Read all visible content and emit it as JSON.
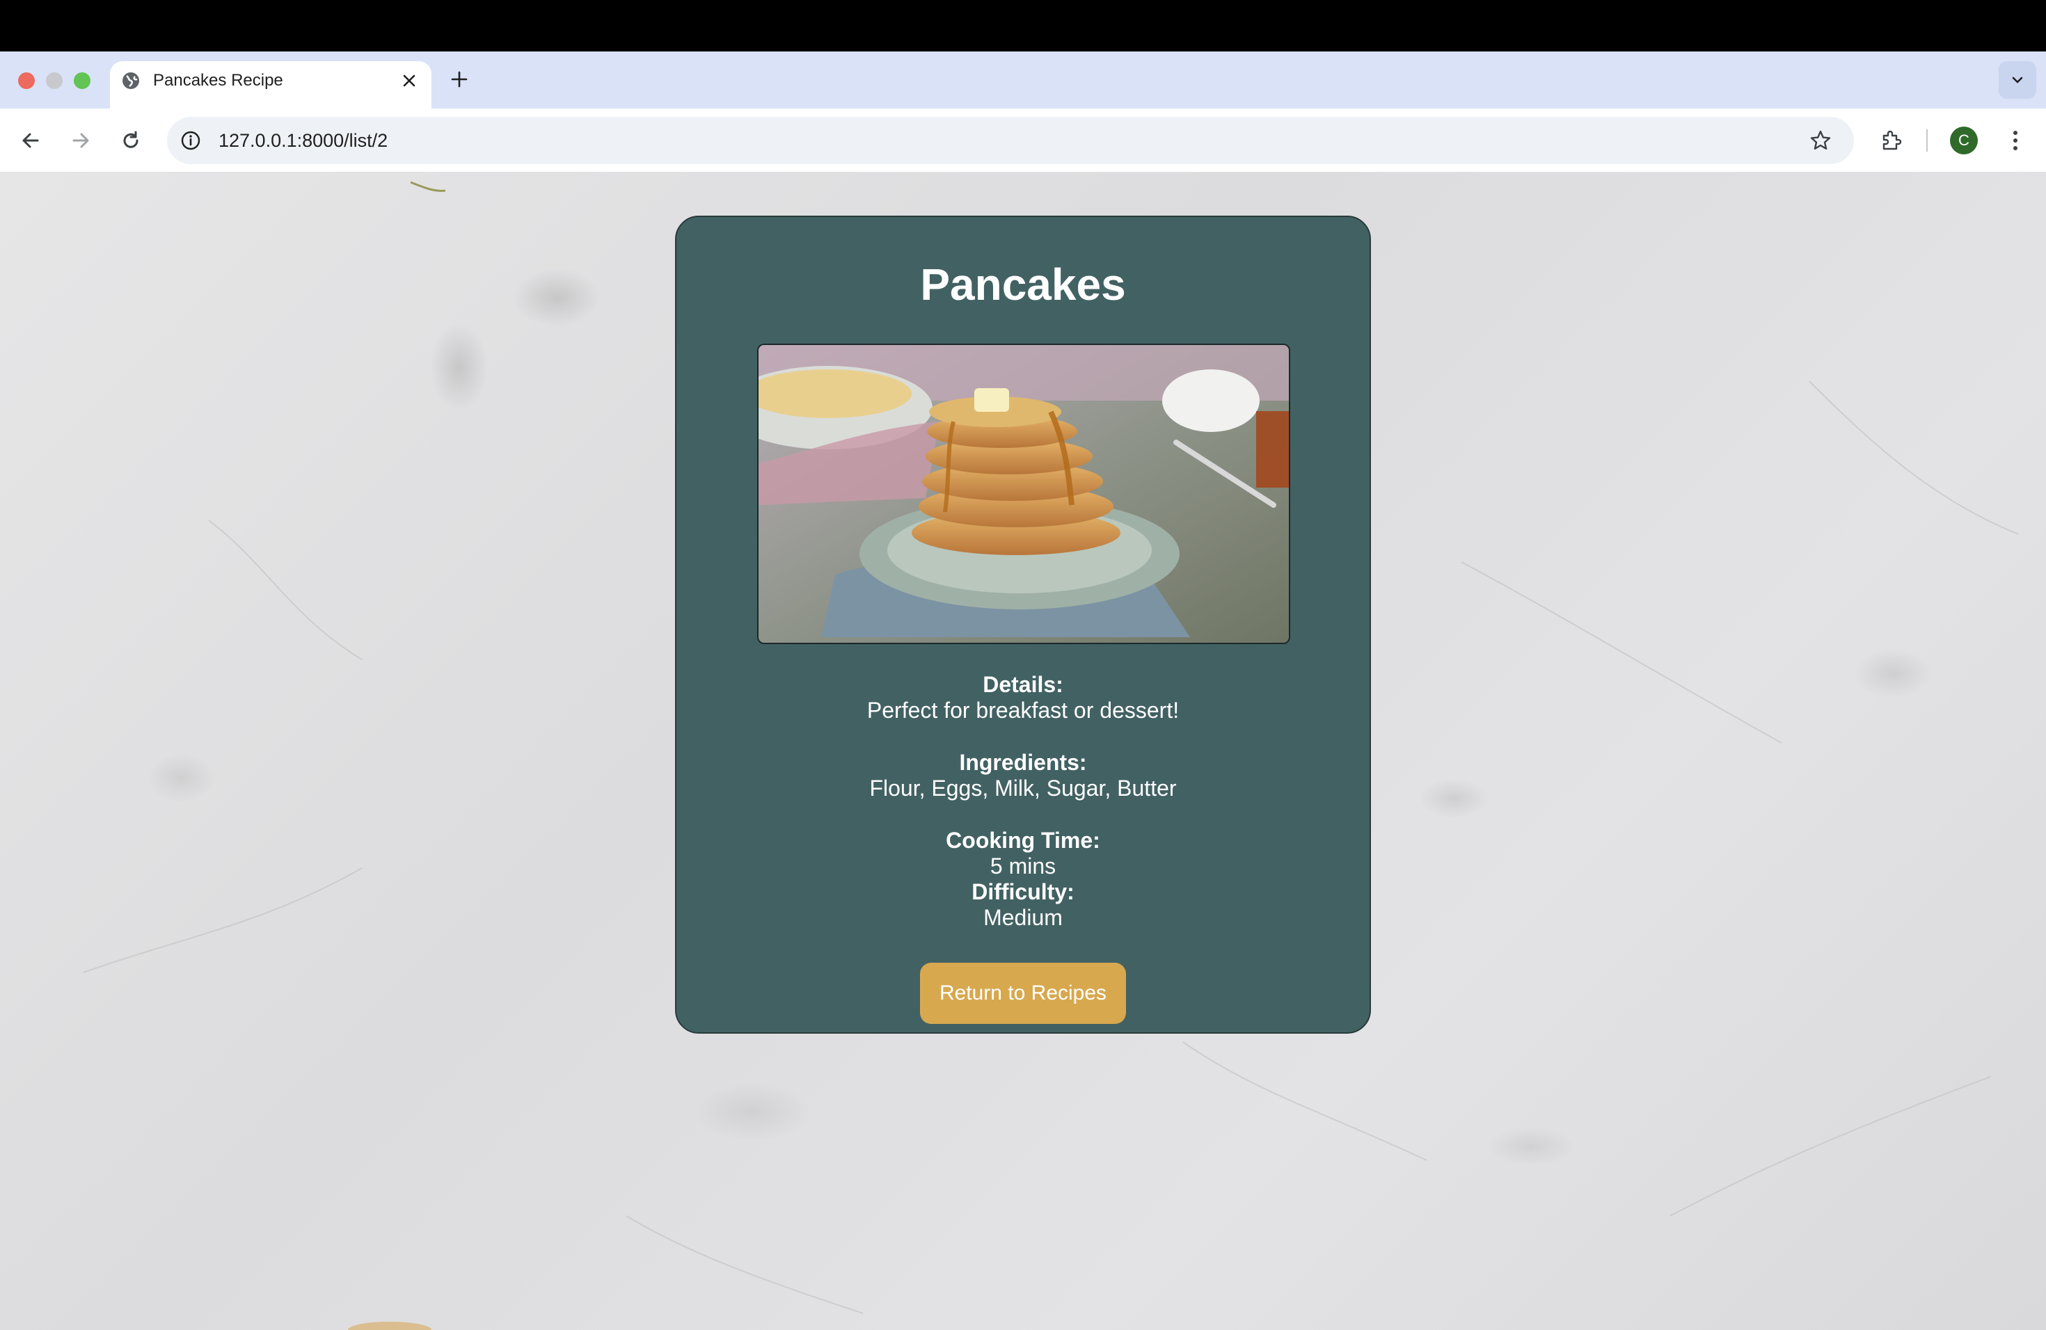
{
  "browser": {
    "tab": {
      "title": "Pancakes Recipe"
    },
    "address_bar": {
      "url": "127.0.0.1:8000/list/2"
    },
    "profile_initial": "C",
    "accent_colors": {
      "tabstrip": "#d9e2f7",
      "avatar": "#2f6a2a"
    }
  },
  "recipe": {
    "title": "Pancakes",
    "image_alt": "Stack of pancakes with syrup and butter",
    "details_label": "Details:",
    "details": "Perfect for breakfast or dessert!",
    "ingredients_label": "Ingredients:",
    "ingredients": "Flour, Eggs, Milk, Sugar, Butter",
    "cooking_time_label": "Cooking Time:",
    "cooking_time": "5 mins",
    "difficulty_label": "Difficulty:",
    "difficulty": "Medium",
    "return_button": "Return to Recipes",
    "colors": {
      "card": "#426163",
      "button": "#d7a84e"
    }
  },
  "icons": {
    "back": "back-arrow-icon",
    "forward": "forward-arrow-icon",
    "reload": "reload-icon",
    "site_info": "info-icon",
    "bookmark": "star-icon",
    "extensions": "puzzle-icon",
    "menu": "kebab-menu-icon",
    "tab_search": "chevron-down-icon",
    "new_tab": "plus-icon",
    "close_tab": "close-icon",
    "favicon": "globe-icon"
  }
}
